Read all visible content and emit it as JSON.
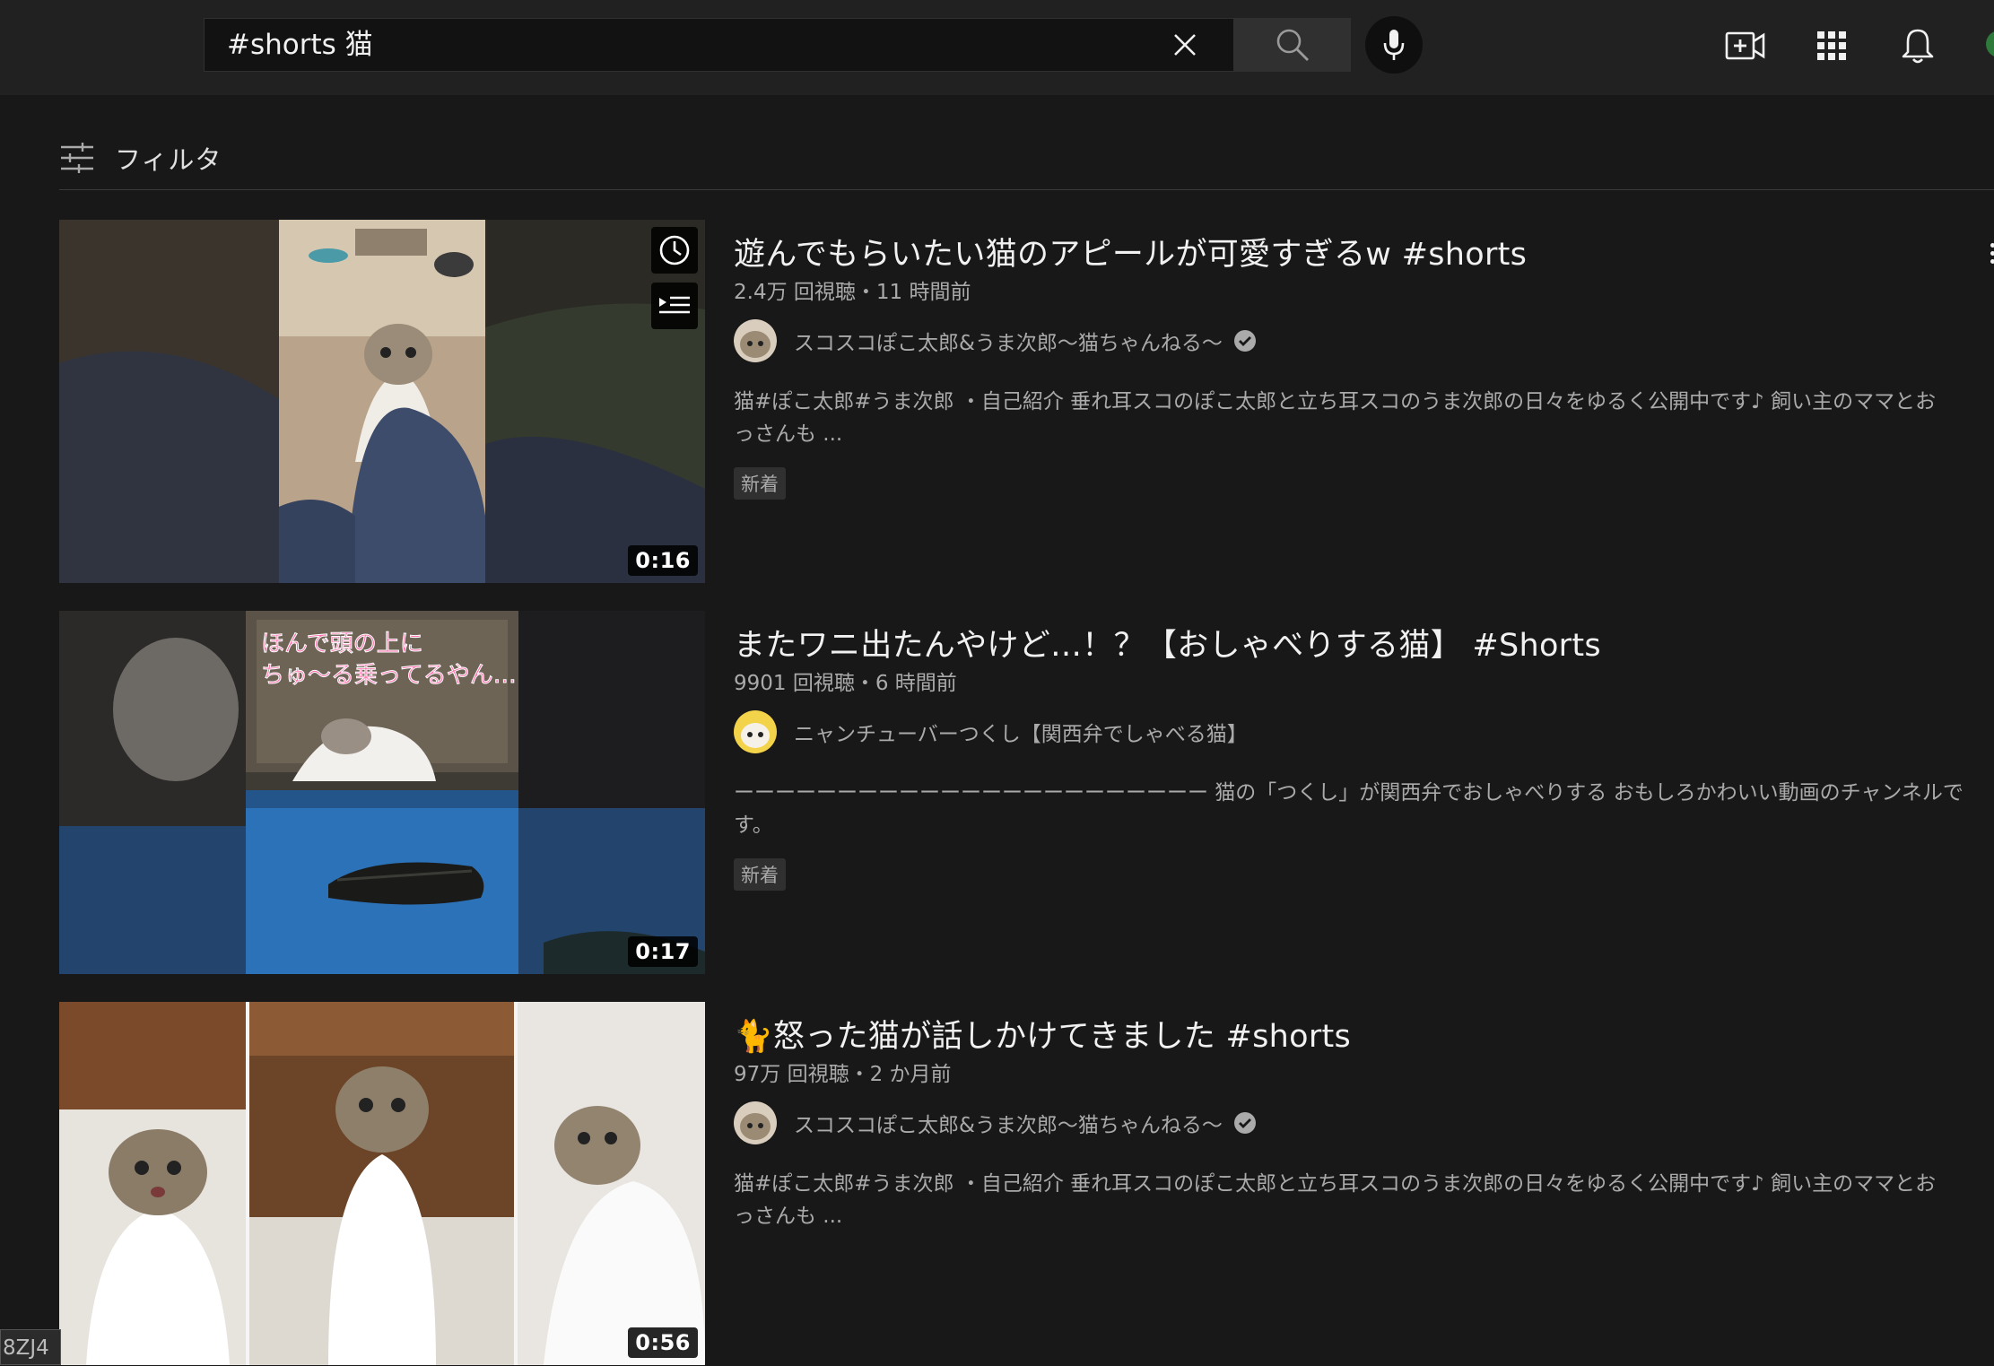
{
  "search": {
    "query": "#shorts 猫"
  },
  "masthead": {
    "icons": [
      "close-icon",
      "search-icon",
      "mic-icon",
      "create-video-icon",
      "apps-grid-icon",
      "notifications-bell-icon"
    ]
  },
  "filter": {
    "label": "フィルタ"
  },
  "results": [
    {
      "title": "遊んでもらいたい猫のアピールが可愛すぎるw #shorts",
      "views": "2.4万 回視聴・11 時間前",
      "channel": "スコスコぽこ太郎&うま次郎〜猫ちゃんねる〜",
      "verified": true,
      "desc_line1": "猫#ぽこ太郎#うま次郎 ・自己紹介 垂れ耳スコのぽこ太郎と立ち耳スコのうま次郎の日々をゆるく公開中です♪ 飼い主のママとお",
      "desc_line2": "っさんも ...",
      "badge": "新着",
      "duration": "0:16"
    },
    {
      "title": "またワニ出たんやけど…！？【おしゃべりする猫】 #Shorts",
      "views": "9901 回視聴・6 時間前",
      "channel": "ニャンチューバーつくし【関西弁でしゃべる猫】",
      "verified": false,
      "desc_line1": "ーーーーーーーーーーーーーーーーーーーーーーー 猫の「つくし」が関西弁でおしゃべりする おもしろかわいい動画のチャンネルで",
      "desc_line2": "す。",
      "badge": "新着",
      "duration": "0:17",
      "caption_line1": "ほんで頭の上に",
      "caption_line2": "ちゅ〜る乗ってるやん…"
    },
    {
      "title": "🐈怒った猫が話しかけてきました #shorts",
      "views": "97万 回視聴・2 か月前",
      "channel": "スコスコぽこ太郎&うま次郎〜猫ちゃんねる〜",
      "verified": true,
      "desc_line1": "猫#ぽこ太郎#うま次郎 ・自己紹介 垂れ耳スコのぽこ太郎と立ち耳スコのうま次郎の日々をゆるく公開中です♪ 飼い主のママとお",
      "desc_line2": "っさんも ...",
      "duration": "0:56"
    }
  ],
  "corner_tag": "8ZJ4",
  "colors": {
    "background": "#181818",
    "masthead": "#212121",
    "text_primary": "#f1f1f1",
    "text_secondary": "#aaaaaa"
  }
}
